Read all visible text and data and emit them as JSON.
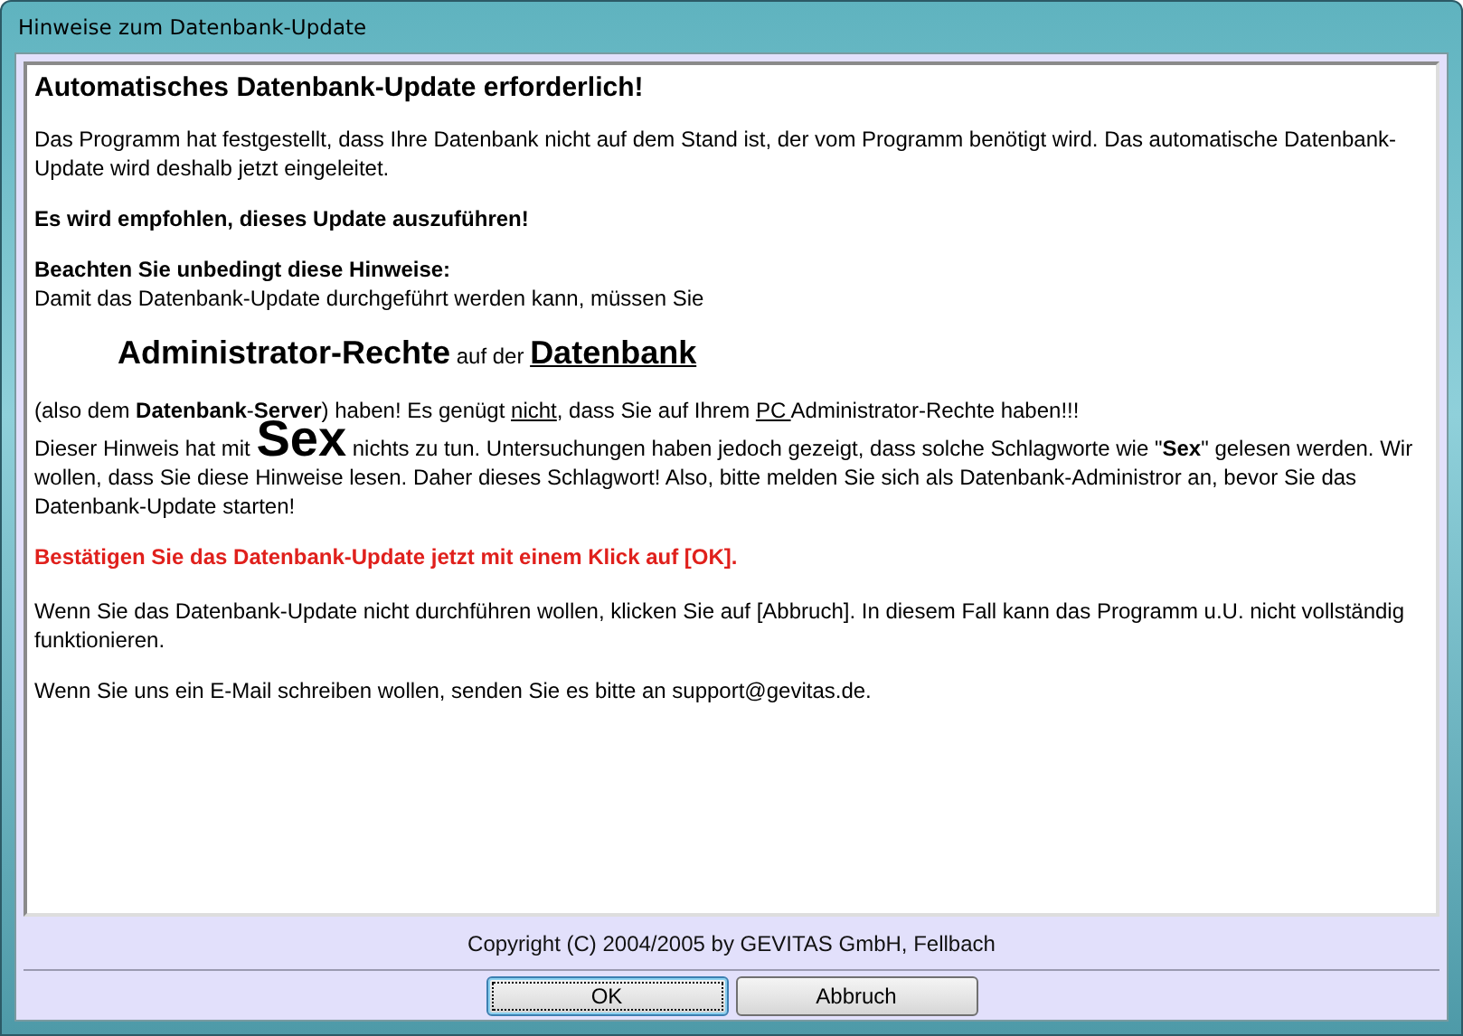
{
  "window": {
    "title": "Hinweise zum Datenbank-Update"
  },
  "paragraphs": [
    {
      "kind": "title",
      "segments": [
        {
          "text": "Automatisches Datenbank-Update erforderlich!"
        }
      ]
    },
    {
      "kind": "text",
      "segments": [
        {
          "text": "Das Programm hat festgestellt, dass Ihre Datenbank nicht auf dem Stand ist, der vom Programm benötigt wird. Das automatische Datenbank-Update wird deshalb jetzt eingeleitet."
        }
      ]
    },
    {
      "kind": "bold",
      "segments": [
        {
          "text": "Es wird empfohlen, dieses Update auszuführen!"
        }
      ]
    },
    {
      "kind": "boldlead",
      "segments": [
        {
          "text": "Beachten Sie unbedingt diese Hinweise:"
        }
      ]
    },
    {
      "kind": "text",
      "segments": [
        {
          "text": "Damit das Datenbank-Update durchgeführt werden kann, müssen Sie"
        }
      ]
    },
    {
      "kind": "display",
      "segments": [
        {
          "text": "Administrator-Rechte",
          "kind": "large",
          "bold": true
        },
        {
          "text": " auf der "
        },
        {
          "text": "Datenbank",
          "kind": "large",
          "bold": true,
          "underline": true
        }
      ]
    },
    {
      "kind": "lead",
      "segments": [
        {
          "text": "(also dem "
        },
        {
          "text": "Datenbank",
          "bold": true
        },
        {
          "text": "-"
        },
        {
          "text": "Server",
          "bold": true
        },
        {
          "text": ") haben! Es genügt "
        },
        {
          "text": "nicht",
          "underline": true
        },
        {
          "text": ", dass Sie auf Ihrem "
        },
        {
          "text": "PC ",
          "underline": true
        },
        {
          "text": "Administrator-Rechte haben!!!"
        }
      ]
    },
    {
      "kind": "text",
      "segments": [
        {
          "text": "Dieser Hinweis hat mit "
        },
        {
          "text": "Sex",
          "kind": "huge",
          "bold": true
        },
        {
          "text": " nichts zu tun. Untersuchungen haben jedoch gezeigt, dass solche Schlagworte wie \""
        },
        {
          "text": "Sex",
          "bold": true
        },
        {
          "text": "\" gelesen werden. Wir wollen, dass Sie diese Hinweise lesen. Daher dieses Schlagwort! Also, bitte melden Sie sich als Datenbank-Administror an, bevor Sie das Datenbank-Update starten!"
        }
      ]
    },
    {
      "kind": "alert",
      "segments": [
        {
          "text": "Bestätigen Sie das Datenbank-Update jetzt mit einem Klick auf [OK]."
        }
      ]
    },
    {
      "kind": "text",
      "segments": [
        {
          "text": "Wenn Sie das Datenbank-Update nicht durchführen wollen, klicken Sie auf [Abbruch]. In diesem Fall kann das Programm u.U. nicht vollständig funktionieren."
        }
      ]
    },
    {
      "kind": "text",
      "segments": [
        {
          "text": "Wenn Sie uns ein E-Mail schreiben wollen, senden Sie es bitte an support@gevitas.de."
        }
      ]
    }
  ],
  "copyright": "Copyright (C) 2004/2005 by GEVITAS GmbH, Fellbach",
  "buttons": [
    {
      "label": "OK",
      "focused": true
    },
    {
      "label": "Abbruch",
      "focused": false
    }
  ]
}
